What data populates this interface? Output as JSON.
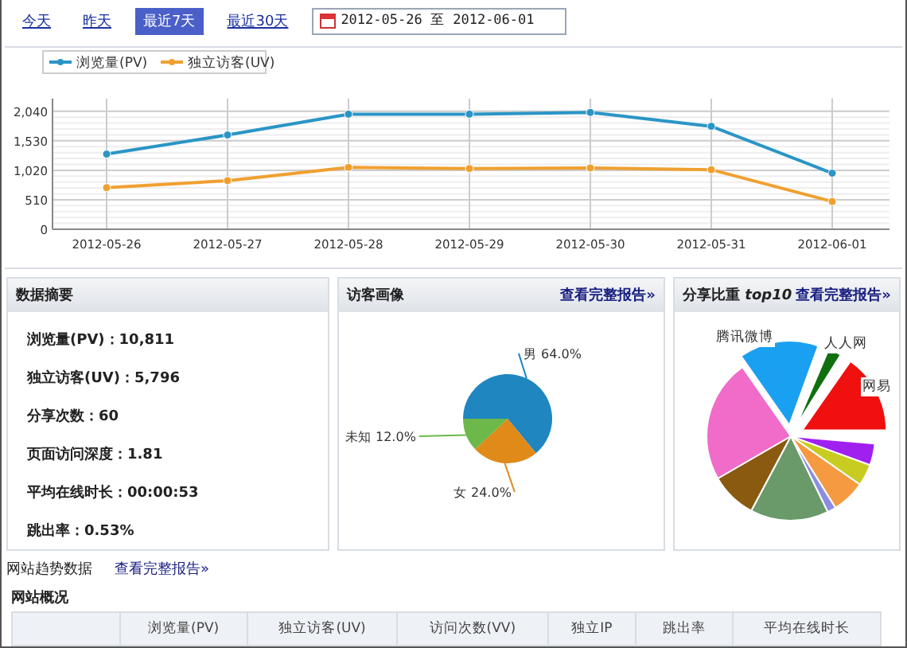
{
  "toolbar": {
    "ranges": [
      {
        "label": "今天",
        "selected": false
      },
      {
        "label": "昨天",
        "selected": false
      },
      {
        "label": "最近7天",
        "selected": true
      },
      {
        "label": "最近30天",
        "selected": false
      }
    ],
    "date_field": {
      "value": "2012-05-26 至 2012-06-01"
    }
  },
  "trend": {
    "chart_data": {
      "type": "line",
      "grid": true,
      "legend": "top-left",
      "categories": [
        "2012-05-26",
        "2012-05-27",
        "2012-05-28",
        "2012-05-29",
        "2012-05-30",
        "2012-05-31",
        "2012-06-01"
      ],
      "ylim": [
        0,
        2200
      ],
      "yticks": [
        0,
        {
          "value": 510,
          "label": "510"
        },
        {
          "value": 1020,
          "label": "1,020"
        },
        {
          "value": 1530,
          "label": "1,530"
        },
        {
          "value": 2040,
          "label": "2,040"
        }
      ],
      "series": [
        {
          "name": "浏览量(PV)",
          "color": "#2b95c6",
          "marker": "circle",
          "values": [
            1300,
            1630,
            1990,
            1990,
            2020,
            1780,
            970
          ]
        },
        {
          "name": "独立访客(UV)",
          "color": "#f0a030",
          "marker": "circle",
          "values": [
            720,
            840,
            1070,
            1050,
            1060,
            1030,
            480
          ]
        }
      ]
    }
  },
  "summary": {
    "title": "数据摘要",
    "items": [
      "浏览量(PV)：10,811",
      "独立访客(UV)：5,796",
      "分享次数：60",
      "页面访问深度：1.81",
      "平均在线时长：00:00:53",
      "跳出率：0.53%"
    ]
  },
  "visitors": {
    "title": "访客画像",
    "link": "查看完整报告»",
    "chart_data": {
      "type": "pie",
      "categories": [
        "男",
        "女",
        "未知"
      ],
      "values": [
        64,
        24,
        12
      ],
      "value_labels": [
        "64.0%",
        "24.0%",
        "12.0%"
      ],
      "colors": [
        "#1f86c0",
        "#e08a1a",
        "#6cb84a"
      ]
    }
  },
  "shares": {
    "title": "分享比重 *top10*",
    "link": "查看完整报告»",
    "labels": [
      "腾讯微博",
      "人人网",
      "网易"
    ]
  },
  "trend_data": {
    "title": "网站趋势数据",
    "link": "查看完整报告»"
  },
  "overview": {
    "title": "网站概况",
    "columns": [
      "",
      "浏览量(PV)",
      "独立访客(UV)",
      "访问次数(VV)",
      "独立IP",
      "跳出率",
      "平均在线时长"
    ]
  }
}
